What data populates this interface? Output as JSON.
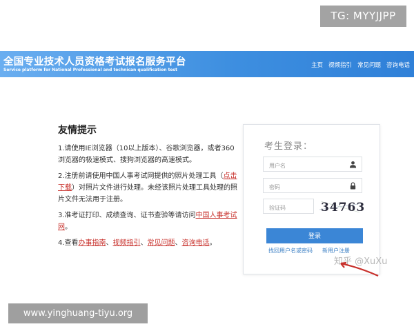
{
  "overlay": {
    "tg_badge": "TG: MYYJJPP",
    "footer_url": "www.yinghuang-tiyu.org",
    "zhihu_watermark": "知乎 @XuXu"
  },
  "header": {
    "title": "全国专业技术人员资格考试报名服务平台",
    "subtitle": "Service platform for National Professional and technican qualification test",
    "nav": [
      "主页",
      "视频指引",
      "常见问题",
      "咨询电话"
    ]
  },
  "tips": {
    "title": "友情提示",
    "tip1": "1.请使用IE浏览器（10以上版本）、谷歌浏览器，或者360浏览器的极速模式、搜狗浏览器的高速模式。",
    "tip2_prefix": "2.注册前请使用中国人事考试网提供的照片处理工具（",
    "tip2_link": "点击下载",
    "tip2_suffix": "）对照片文件进行处理。未经该照片处理工具处理的照片文件无法用于注册。",
    "tip3_prefix": "3.准考证打印、成绩查询、证书查验等请访问",
    "tip3_link": "中国人事考试网",
    "tip3_suffix": "。",
    "tip4_prefix": "4.查看",
    "tip4_links": [
      "办事指南",
      "视频指引",
      "常见问题",
      "咨询电话"
    ],
    "tip4_sep": "、",
    "tip4_suffix": "。"
  },
  "login": {
    "title": "考生登录：",
    "username_placeholder": "用户名",
    "password_placeholder": "密码",
    "captcha_placeholder": "验证码",
    "captcha_text": "34763",
    "login_button": "登录",
    "forgot_link": "找回用户名或密码",
    "register_link": "新用户注册"
  },
  "colors": {
    "header_blue": "#3e8fe0",
    "button_blue": "#3b86d6",
    "link_red": "#c8312c",
    "link_blue": "#3b7fc4"
  }
}
